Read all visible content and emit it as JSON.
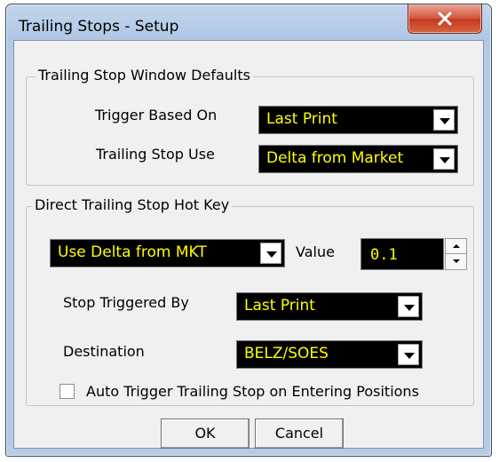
{
  "window": {
    "title": "Trailing Stops - Setup",
    "close_icon": "close-x-icon"
  },
  "defaults_group": {
    "legend": "Trailing Stop Window Defaults",
    "trigger_label": "Trigger Based On",
    "trigger_value": "Last Print",
    "use_label": "Trailing Stop Use",
    "use_value": "Delta from Market"
  },
  "hotkey_group": {
    "legend": "Direct Trailing Stop Hot Key",
    "mode_value": "Use Delta from MKT",
    "value_label": "Value",
    "value": "0.1",
    "triggered_label": "Stop Triggered By",
    "triggered_value": "Last Print",
    "destination_label": "Destination",
    "destination_value": "BELZ/SOES",
    "auto_trigger_label": "Auto Trigger Trailing Stop on Entering Positions",
    "auto_trigger_checked": false
  },
  "buttons": {
    "ok": "OK",
    "cancel": "Cancel"
  },
  "colors": {
    "field_background": "#000000",
    "field_text": "#ffff00",
    "close_button": "#c9482c"
  }
}
